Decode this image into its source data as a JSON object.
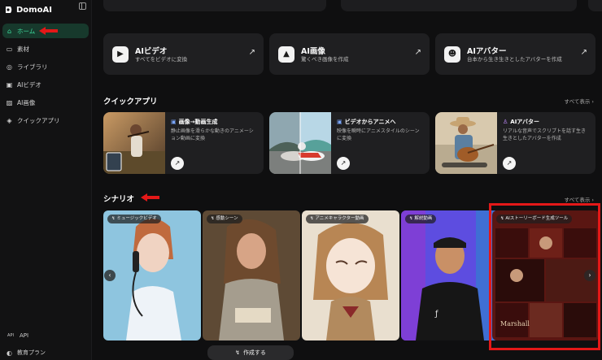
{
  "brand": {
    "name": "DomoAI"
  },
  "sidebar": {
    "items": [
      {
        "label": "ホーム",
        "icon": "home-icon",
        "glyph": "⌂",
        "active": true
      },
      {
        "label": "素材",
        "icon": "folder-icon",
        "glyph": "▭",
        "active": false
      },
      {
        "label": "ライブラリ",
        "icon": "library-icon",
        "glyph": "◎",
        "active": false
      },
      {
        "label": "AIビデオ",
        "icon": "video-icon",
        "glyph": "▣",
        "active": false
      },
      {
        "label": "AI画像",
        "icon": "image-icon",
        "glyph": "▨",
        "active": false
      },
      {
        "label": "クイックアプリ",
        "icon": "apps-icon",
        "glyph": "◈",
        "active": false
      }
    ],
    "bottom": [
      {
        "label": "API",
        "prefix": "API"
      },
      {
        "label": "教育プラン",
        "prefix": "◐"
      }
    ]
  },
  "features": [
    {
      "title": "AIビデオ",
      "desc": "すべてをビデオに変換",
      "icon": "video-camera-icon",
      "glyph": "▶"
    },
    {
      "title": "AI画像",
      "desc": "驚くべき画像を作成",
      "icon": "picture-icon",
      "glyph": "▲"
    },
    {
      "title": "AIアバター",
      "desc": "台本から生き生きとしたアバターを作成",
      "icon": "avatar-icon",
      "glyph": "☻"
    }
  ],
  "quick_apps": {
    "title": "クイックアプリ",
    "see_all": "すべて表示 ›",
    "items": [
      {
        "title": "画像→動画生成",
        "desc": "静止画像を滑らかな動きのアニメーション動画に変換",
        "glyph": "▣"
      },
      {
        "title": "ビデオからアニメへ",
        "desc": "映像を瞬時にアニメスタイルのシーンに変換",
        "glyph": "▣"
      },
      {
        "title": "AIアバター",
        "desc": "リアルな音声でスクリプトを話す生き生きとしたアバターを作成",
        "glyph": "♙"
      }
    ],
    "arrow": "↗"
  },
  "scenarios": {
    "title": "シナリオ",
    "see_all": "すべて表示 ›",
    "items": [
      {
        "tag": "ミュージックビデオ"
      },
      {
        "tag": "感動シーン"
      },
      {
        "tag": "アニメキャラクター動画"
      },
      {
        "tag": "解説動画"
      },
      {
        "tag": "AIストーリーボード生成ツール"
      }
    ],
    "create_label": "作成する",
    "prev": "‹",
    "next": "›"
  },
  "colors": {
    "accent": "#3fe0a0",
    "highlight": "#e31818",
    "card": "#1f1f21"
  }
}
